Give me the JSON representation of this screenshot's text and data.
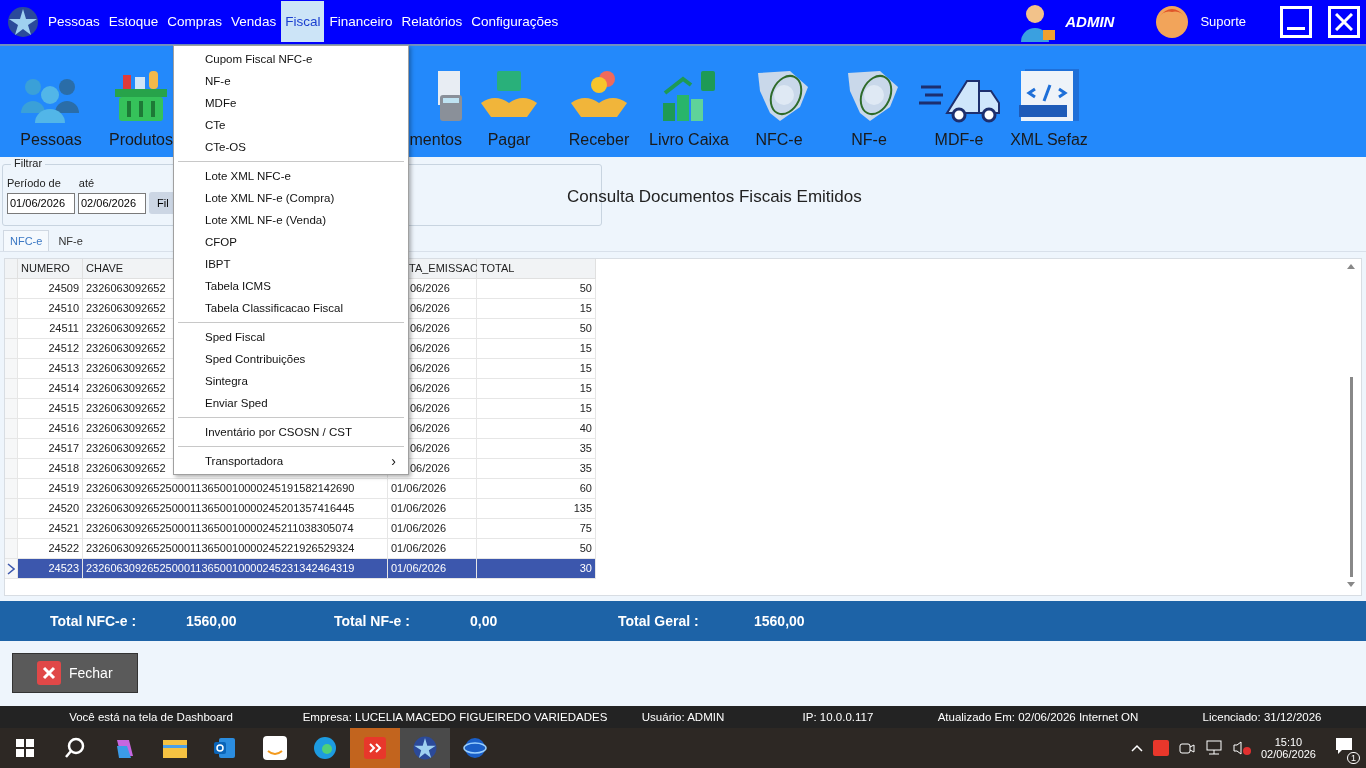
{
  "menubar": {
    "items": [
      {
        "label": "Pessoas",
        "selected": false
      },
      {
        "label": "Estoque",
        "selected": false
      },
      {
        "label": "Compras",
        "selected": false
      },
      {
        "label": "Vendas",
        "selected": false
      },
      {
        "label": "Fiscal",
        "selected": true
      },
      {
        "label": "Financeiro",
        "selected": false
      },
      {
        "label": "Relatórios",
        "selected": false
      },
      {
        "label": "Configurações",
        "selected": false
      }
    ],
    "user": "ADMIN",
    "support": "Suporte"
  },
  "toolbar": [
    {
      "label": "Pessoas",
      "kind": "people"
    },
    {
      "label": "Produtos",
      "kind": "basket"
    },
    {
      "kind": "hidden"
    },
    {
      "label": "mentos",
      "kind": "calc"
    },
    {
      "label": "Pagar",
      "kind": "pay"
    },
    {
      "label": "Receber",
      "kind": "receive"
    },
    {
      "label": "Livro Caixa",
      "kind": "chart"
    },
    {
      "label": "NFC-e",
      "kind": "nfce"
    },
    {
      "label": "NF-e",
      "kind": "nfe"
    },
    {
      "label": "MDF-e",
      "kind": "truck"
    },
    {
      "label": "XML Sefaz",
      "kind": "xml"
    }
  ],
  "filter": {
    "legend": "Filtrar",
    "from_label": "Período de",
    "to_label": "até",
    "from": "01/06/2026",
    "to": "02/06/2026",
    "button": "Fil"
  },
  "title": "Consulta Documentos Fiscais Emitidos",
  "tabs": [
    {
      "label": "NFC-e",
      "selected": true
    },
    {
      "label": "NF-e",
      "selected": false
    }
  ],
  "table": {
    "columns": [
      "NUMERO",
      "CHAVE",
      "TA_EMISSAO",
      "TOTAL"
    ],
    "rows": [
      {
        "numero": "24509",
        "chave": "2326063092652",
        "data": "06/2026",
        "total": "50",
        "selected": false
      },
      {
        "numero": "24510",
        "chave": "2326063092652",
        "data": "06/2026",
        "total": "15",
        "selected": false
      },
      {
        "numero": "24511",
        "chave": "2326063092652",
        "data": "06/2026",
        "total": "50",
        "selected": false
      },
      {
        "numero": "24512",
        "chave": "2326063092652",
        "data": "06/2026",
        "total": "15",
        "selected": false
      },
      {
        "numero": "24513",
        "chave": "2326063092652",
        "data": "06/2026",
        "total": "15",
        "selected": false
      },
      {
        "numero": "24514",
        "chave": "2326063092652",
        "data": "06/2026",
        "total": "15",
        "selected": false
      },
      {
        "numero": "24515",
        "chave": "2326063092652",
        "data": "06/2026",
        "total": "15",
        "selected": false
      },
      {
        "numero": "24516",
        "chave": "2326063092652",
        "data": "06/2026",
        "total": "40",
        "selected": false
      },
      {
        "numero": "24517",
        "chave": "2326063092652",
        "data": "06/2026",
        "total": "35",
        "selected": false
      },
      {
        "numero": "24518",
        "chave": "2326063092652",
        "data": "06/2026",
        "total": "35",
        "selected": false
      },
      {
        "numero": "24519",
        "chave": "23260630926525000113650010000245191582142690",
        "data": "01/06/2026",
        "total": "60",
        "selected": false
      },
      {
        "numero": "24520",
        "chave": "23260630926525000113650010000245201357416445",
        "data": "01/06/2026",
        "total": "135",
        "selected": false
      },
      {
        "numero": "24521",
        "chave": "23260630926525000113650010000245211038305074",
        "data": "01/06/2026",
        "total": "75",
        "selected": false
      },
      {
        "numero": "24522",
        "chave": "23260630926525000113650010000245221926529324",
        "data": "01/06/2026",
        "total": "50",
        "selected": false
      },
      {
        "numero": "24523",
        "chave": "23260630926525000113650010000245231342464319",
        "data": "01/06/2026",
        "total": "30",
        "selected": true
      }
    ]
  },
  "totals": [
    {
      "label": "Total NFC-e :",
      "value": "1560,00"
    },
    {
      "label": "Total NF-e :",
      "value": "0,00"
    },
    {
      "label": "Total Geral :",
      "value": "1560,00"
    }
  ],
  "close_button": "Fechar",
  "status_bar": [
    "Você está na tela de Dashboard",
    "Empresa: LUCELIA MACEDO FIGUEIREDO VARIEDADES",
    "Usuário: ADMIN",
    "IP: 10.0.0.117",
    "Atualizado Em: 02/06/2026  Internet ON",
    "Licenciado: 31/12/2026"
  ],
  "menu": {
    "groups": [
      [
        "Cupom Fiscal NFC-e",
        "NF-e",
        "MDFe",
        "CTe",
        "CTe-OS"
      ],
      [
        "Lote XML NFC-e",
        "Lote XML NF-e (Compra)",
        "Lote XML NF-e (Venda)",
        "CFOP",
        "IBPT",
        "Tabela ICMS",
        "Tabela Classificacao Fiscal"
      ],
      [
        "Sped Fiscal",
        "Sped Contribuições",
        "Sintegra",
        "Enviar Sped"
      ],
      [
        "Inventário por CSOSN / CST"
      ],
      [
        "Transportadora"
      ]
    ],
    "submenu_arrow": "›"
  },
  "taskbar": {
    "time": "15:10",
    "date": "02/06/2026",
    "notifications": "1"
  }
}
